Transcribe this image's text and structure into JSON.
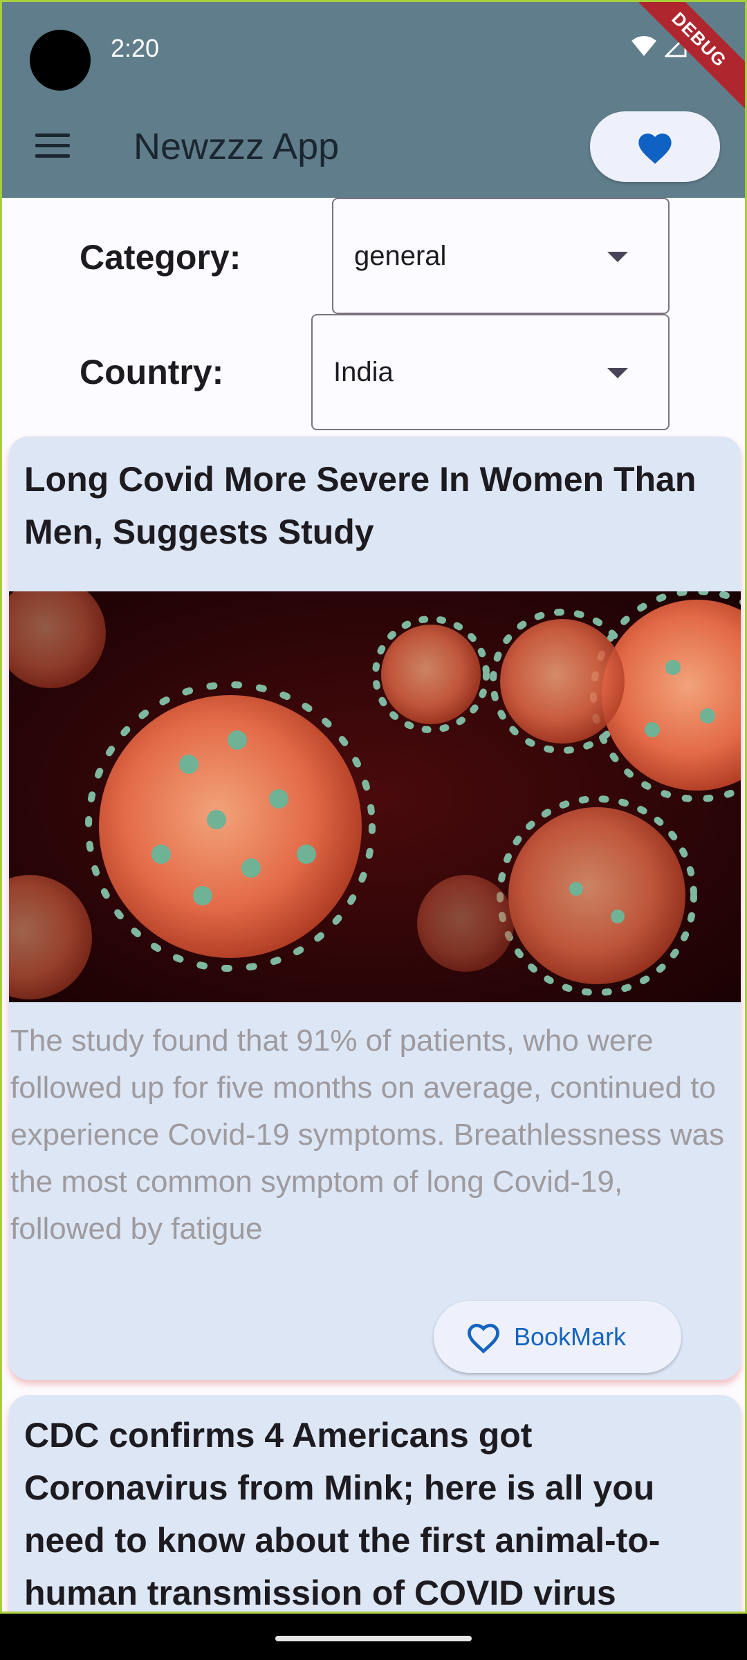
{
  "status_bar": {
    "time": "2:20",
    "debug_label": "DEBUG"
  },
  "app_bar": {
    "title": "Newzzz App",
    "menu_icon": "menu-icon",
    "favorites_icon": "heart-icon"
  },
  "filters": {
    "category_label": "Category:",
    "category_value": "general",
    "country_label": "Country:",
    "country_value": "India"
  },
  "articles": [
    {
      "title": "Long Covid More Severe In Women Than Men, Suggests Study",
      "description": "The study found that 91% of patients, who were followed up for five months on average, continued to experience Covid-19 symptoms. Breathlessness was the most common symptom of long Covid-19, followed by fatigue",
      "bookmark_label": "BookMark"
    },
    {
      "title": "CDC confirms 4 Americans got Coronavirus from Mink; here is all you need to know about the first animal-to-human transmission of COVID virus"
    }
  ],
  "colors": {
    "app_bar": "#607d8b",
    "card_background": "#dce6f5",
    "accent": "#1565c0"
  }
}
